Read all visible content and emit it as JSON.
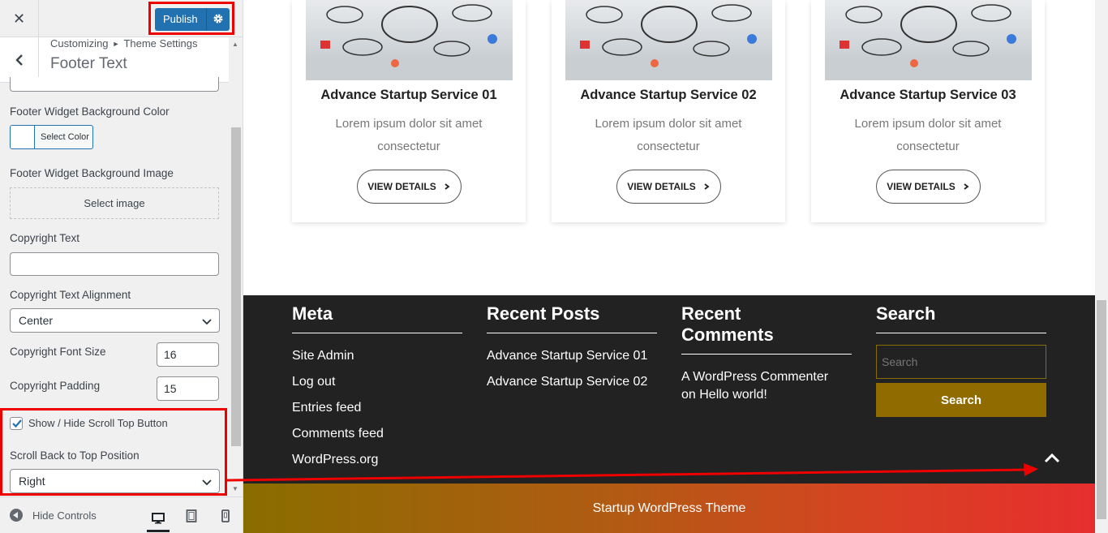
{
  "customizer": {
    "close_icon": "close-icon",
    "publish_label": "Publish",
    "breadcrumb_root": "Customizing",
    "breadcrumb_parent": "Theme Settings",
    "section_title": "Footer Text",
    "controls": {
      "footer_widget_bg_color_label": "Footer Widget Background Color",
      "select_color_label": "Select Color",
      "footer_widget_bg_image_label": "Footer Widget Background Image",
      "select_image_label": "Select image",
      "copyright_text_label": "Copyright Text",
      "copyright_text_value": "",
      "copyright_alignment_label": "Copyright Text Alignment",
      "copyright_alignment_value": "Center",
      "copyright_font_size_label": "Copyright Font Size",
      "copyright_font_size_value": "16",
      "copyright_padding_label": "Copyright Padding",
      "copyright_padding_value": "15",
      "scroll_top_checkbox_label": "Show / Hide Scroll Top Button",
      "scroll_top_checked": true,
      "scroll_position_label": "Scroll Back to Top Position",
      "scroll_position_value": "Right"
    },
    "footer": {
      "hide_controls_label": "Hide Controls",
      "devices": [
        "desktop",
        "tablet",
        "mobile"
      ],
      "active_device": "desktop"
    }
  },
  "preview": {
    "cards": [
      {
        "title": "Advance Startup Service 01",
        "desc": "Lorem ipsum dolor sit amet consectetur",
        "button": "VIEW DETAILS"
      },
      {
        "title": "Advance Startup Service 02",
        "desc": "Lorem ipsum dolor sit amet consectetur",
        "button": "VIEW DETAILS"
      },
      {
        "title": "Advance Startup Service 03",
        "desc": "Lorem ipsum dolor sit amet consectetur",
        "button": "VIEW DETAILS"
      }
    ],
    "footer": {
      "meta_title": "Meta",
      "meta_links": [
        "Site Admin",
        "Log out",
        "Entries feed",
        "Comments feed",
        "WordPress.org"
      ],
      "recent_posts_title": "Recent Posts",
      "recent_posts": [
        "Advance Startup Service 01",
        "Advance Startup Service 02"
      ],
      "recent_comments_title_1": "Recent",
      "recent_comments_title_2": "Comments",
      "recent_comment_line_1": "A WordPress Commenter",
      "recent_comment_line_2": "on Hello world!",
      "search_title": "Search",
      "search_placeholder": "Search",
      "search_button": "Search"
    },
    "copyright": "Startup WordPress Theme"
  },
  "colors": {
    "publish_blue": "#2271b1",
    "highlight_red": "#e00000",
    "footer_dark": "#222222",
    "search_button_gold": "#8f6b00"
  }
}
